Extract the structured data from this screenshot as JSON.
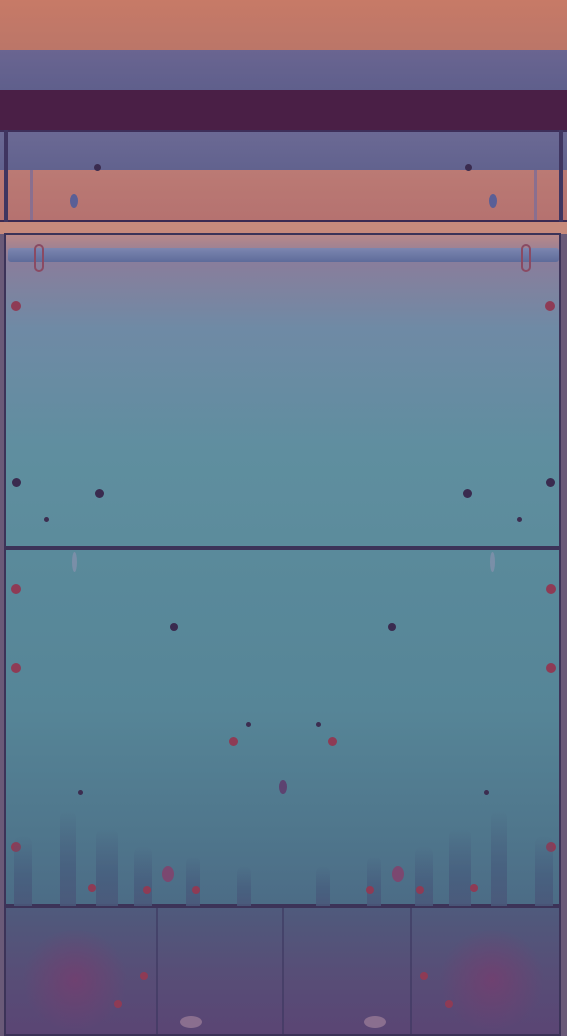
{
  "scene": {
    "description_tags": [
      "symmetric-abstract-image",
      "horizontal-bands",
      "panels"
    ],
    "palette": {
      "salmon": "#c77a67",
      "slate": "#6a6591",
      "dark_plum": "#4a1f46",
      "teal": "#5f8e9f",
      "blue_grey": "#4c6c86",
      "purple": "#5a4574",
      "dot_red": "#8e3b55",
      "dot_dark": "#3a2b4f"
    }
  }
}
